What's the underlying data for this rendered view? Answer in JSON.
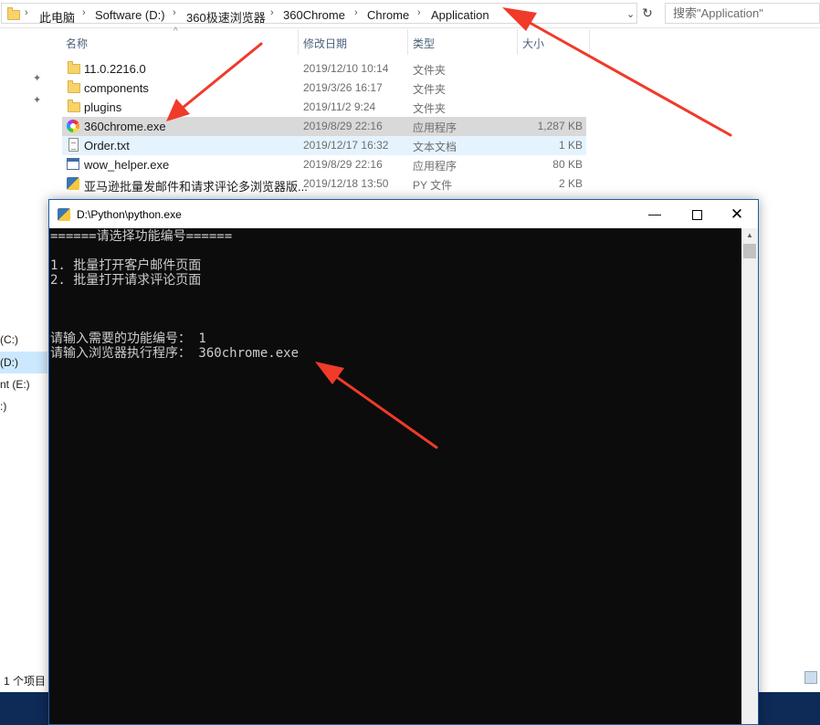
{
  "explorer": {
    "breadcrumb": [
      "此电脑",
      "Software (D:)",
      "360极速浏览器",
      "360Chrome",
      "Chrome",
      "Application"
    ],
    "search_placeholder": "搜索\"Application\"",
    "columns": {
      "name": "名称",
      "date": "修改日期",
      "type": "类型",
      "size": "大小"
    },
    "files": [
      {
        "name": "11.0.2216.0",
        "date": "2019/12/10 10:14",
        "type": "文件夹",
        "size": "",
        "icon": "folder-icon"
      },
      {
        "name": "components",
        "date": "2019/3/26 16:17",
        "type": "文件夹",
        "size": "",
        "icon": "folder-icon"
      },
      {
        "name": "plugins",
        "date": "2019/11/2 9:24",
        "type": "文件夹",
        "size": "",
        "icon": "folder-icon"
      },
      {
        "name": "360chrome.exe",
        "date": "2019/8/29 22:16",
        "type": "应用程序",
        "size": "1,287 KB",
        "icon": "360chrome-icon"
      },
      {
        "name": "Order.txt",
        "date": "2019/12/17 16:32",
        "type": "文本文档",
        "size": "1 KB",
        "icon": "text-file-icon"
      },
      {
        "name": "wow_helper.exe",
        "date": "2019/8/29 22:16",
        "type": "应用程序",
        "size": "80 KB",
        "icon": "application-icon"
      },
      {
        "name": "亚马逊批量发邮件和请求评论多浏览器版...",
        "date": "2019/12/18 13:50",
        "type": "PY 文件",
        "size": "2 KB",
        "icon": "python-file-icon"
      }
    ],
    "nav_drives": [
      "(C:)",
      "(D:)",
      "nt (E:)",
      ":)"
    ],
    "status": "1 个项目"
  },
  "console": {
    "title": "D:\\Python\\python.exe",
    "lines": [
      "======请选择功能编号======",
      "",
      "1. 批量打开客户邮件页面",
      "2. 批量打开请求评论页面",
      "",
      "",
      "",
      "请输入需要的功能编号： 1",
      "请输入浏览器执行程序： 360chrome.exe"
    ]
  },
  "colors": {
    "annotation_arrow": "#f03a2a",
    "console_bg": "#0c0c0c",
    "console_text": "#cccccc",
    "selected_row": "#d9d9d9",
    "hover_row": "#e5f3ff"
  }
}
